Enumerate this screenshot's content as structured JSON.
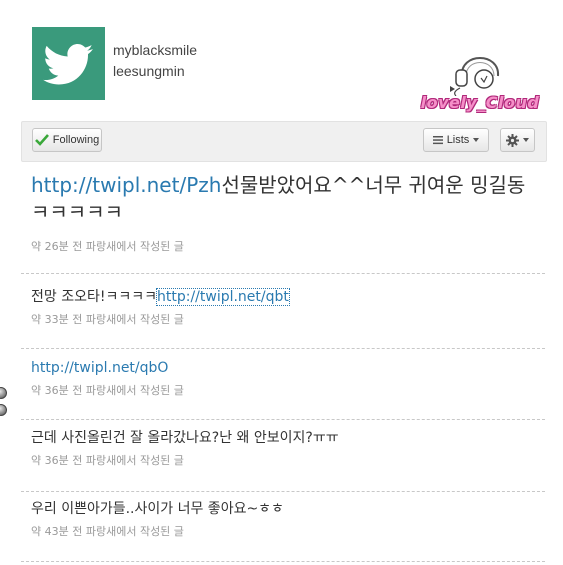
{
  "profile": {
    "screen_name": "myblacksmile",
    "full_name": "leesungmin",
    "avatar_icon": "twitter-bird-icon",
    "avatar_color": "#3a9a7c"
  },
  "logo": {
    "text": "lovely_Cloud",
    "icon": "headphones-icon"
  },
  "toolbar": {
    "following_label": "Following",
    "lists_label": "Lists",
    "settings_icon": "gear-icon"
  },
  "tweets": [
    {
      "link": "http://twipl.net/Pzh",
      "text": "선물받았어요^^너무 귀여운 밍길동 ㅋㅋㅋㅋㅋ",
      "meta": "약 26분 전 파랑새에서 작성된 글"
    },
    {
      "text": "전망 조오타!ㅋㅋㅋㅋ",
      "link": "http://twipl.net/qbt",
      "meta": "약 33분 전 파랑새에서 작성된 글"
    },
    {
      "link": "http://twipl.net/qbO",
      "meta": "약 36분 전 파랑새에서 작성된 글"
    },
    {
      "text": "근데 사진올린건 잘 올라갔나요?난 왜 안보이지?ㅠㅠ",
      "meta": "약 36분 전 파랑새에서 작성된 글"
    },
    {
      "text": "우리 이쁜아가들..사이가 너무 좋아요~ㅎㅎ",
      "meta": "약 43분 전 파랑새에서 작성된 글"
    }
  ],
  "colors": {
    "link": "#2a7ab0",
    "logo_pink": "#f58fc8"
  }
}
